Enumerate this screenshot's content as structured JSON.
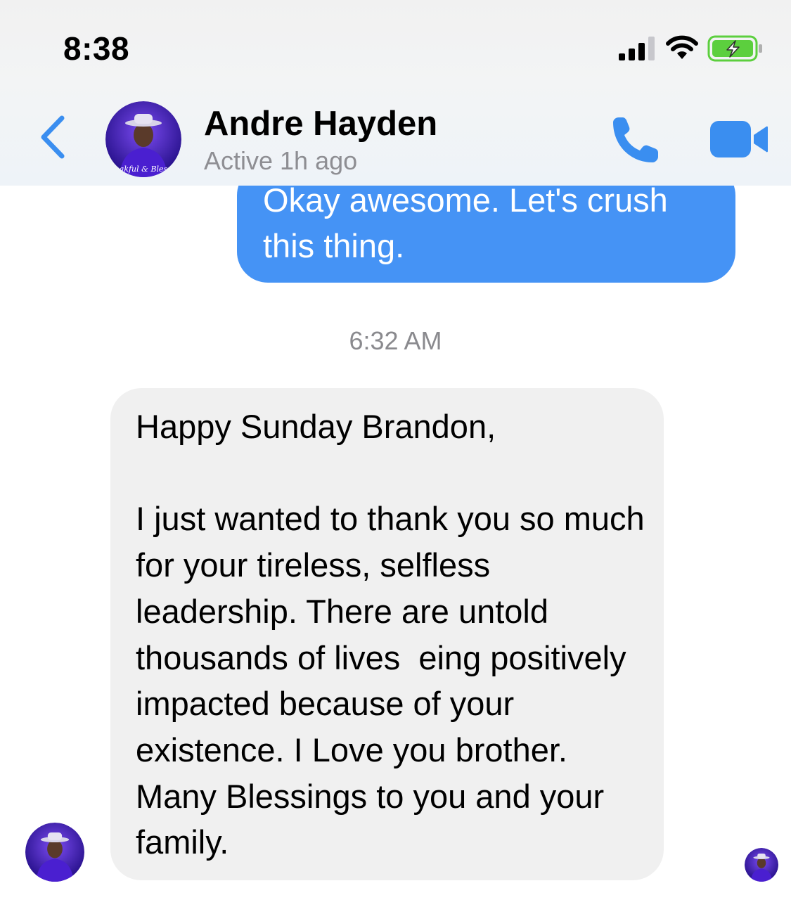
{
  "status_bar": {
    "time": "8:38",
    "icons": [
      "cellular-signal-icon",
      "wifi-icon",
      "battery-charging-icon"
    ]
  },
  "header": {
    "back_icon": "chevron-left-icon",
    "contact_name": "Andre Hayden",
    "contact_status": "Active 1h ago",
    "actions": [
      "phone-icon",
      "video-camera-icon"
    ],
    "avatar_text": "Thankful & Blessed"
  },
  "messages": [
    {
      "direction": "outgoing",
      "text": "Okay awesome. Let's crush this thing."
    },
    {
      "type": "timestamp",
      "text": "6:32 AM"
    },
    {
      "direction": "incoming",
      "text": "Happy Sunday Brandon,\n\nI just wanted to thank you so much for your tireless, selfless leadership. There are untold thousands of lives  eing positively impacted because of your existence. I Love you brother. Many Blessings to you and your family."
    }
  ],
  "colors": {
    "accent": "#3a8ef0",
    "outgoing_bubble": "#4593f5",
    "incoming_bubble": "#f0f0f0",
    "battery_fill": "#5ccf3e",
    "avatar_purple": "#3c16b8"
  }
}
